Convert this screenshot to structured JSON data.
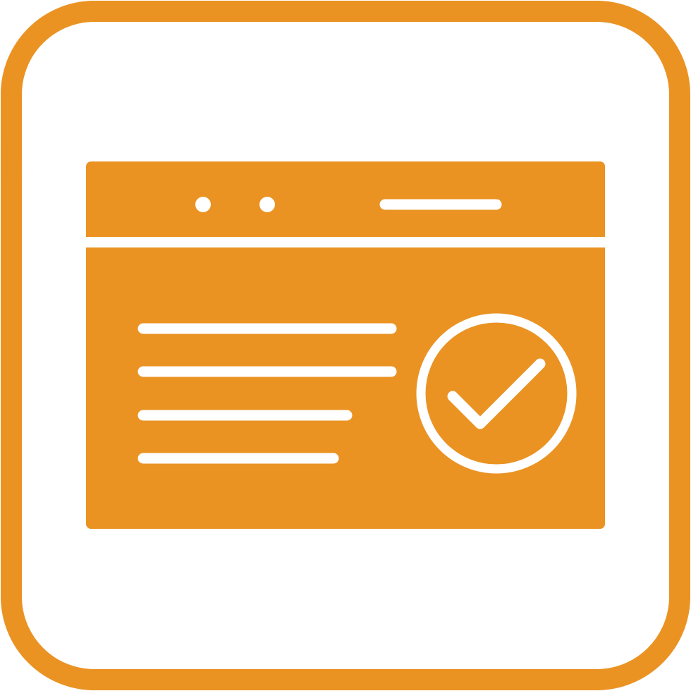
{
  "icon": {
    "name": "web-page-verified-icon",
    "accent_color": "#EA9323",
    "background_color": "#FFFFFF",
    "elements": {
      "frame": "rounded-square-frame",
      "window": "browser-window",
      "title_bar_dots": 2,
      "address_bar": "address-bar-line",
      "text_lines": 4,
      "badge": "check-circle-icon"
    }
  }
}
